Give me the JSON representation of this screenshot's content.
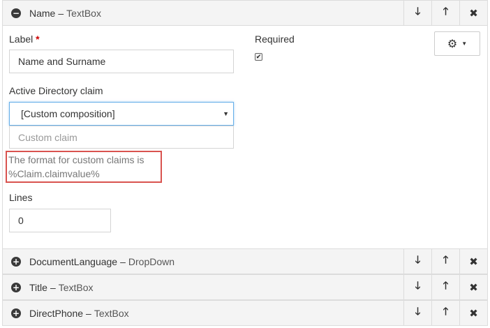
{
  "expanded_field": {
    "name": "Name",
    "separator": "–",
    "type": "TextBox",
    "toggle_icon": "minus-circle-icon"
  },
  "actions": {
    "down_icon": "arrow-down-icon",
    "up_icon": "arrow-up-icon",
    "close_icon": "close-icon",
    "down_glyph": "🡓",
    "up_glyph": "🡑",
    "close_glyph": "✖"
  },
  "form": {
    "label_label": "Label",
    "required_mark": "*",
    "label_value": "Name and Surname",
    "required_label": "Required",
    "required_checked": true,
    "ad_claim_label": "Active Directory claim",
    "ad_claim_selected": "[Custom composition]",
    "custom_claim_placeholder": "Custom claim",
    "hint_line1": "The format for custom claims is",
    "hint_line2": "%Claim.claimvalue%",
    "lines_label": "Lines",
    "lines_value": "0"
  },
  "collapsed_fields": [
    {
      "name": "DocumentLanguage",
      "separator": "–",
      "type": "DropDown"
    },
    {
      "name": "Title",
      "separator": "–",
      "type": "TextBox"
    },
    {
      "name": "DirectPhone",
      "separator": "–",
      "type": "TextBox"
    }
  ],
  "colors": {
    "header_bg": "#f4f4f4",
    "border": "#dcdcdc",
    "highlight": "#d9534f",
    "focus": "#66afe9"
  }
}
